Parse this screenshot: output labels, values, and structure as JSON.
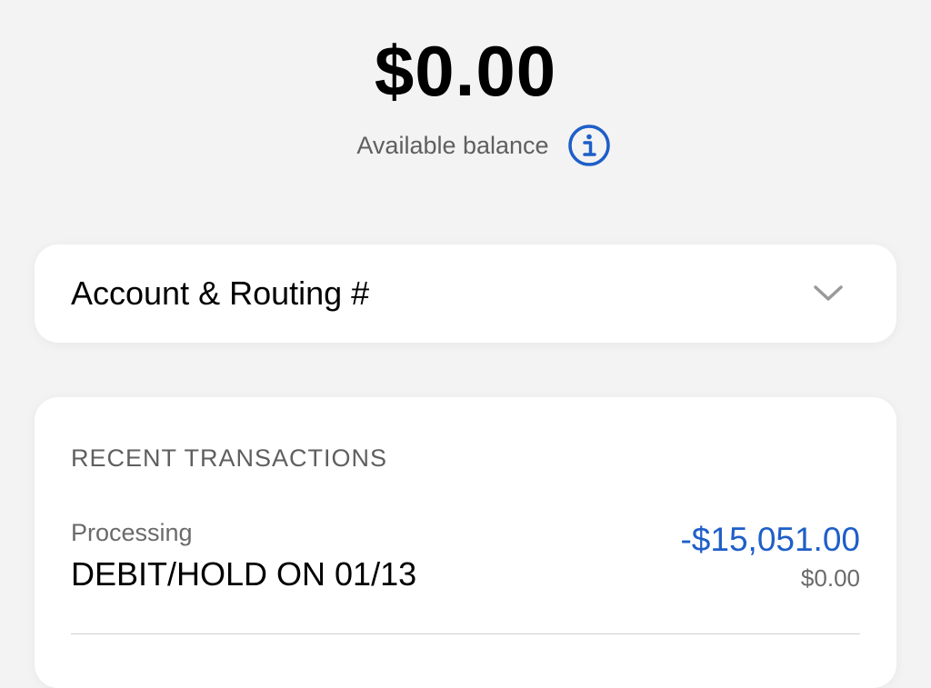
{
  "balance": {
    "amount": "$0.00",
    "label": "Available balance"
  },
  "account_card": {
    "label": "Account & Routing #"
  },
  "transactions": {
    "header": "RECENT TRANSACTIONS",
    "items": [
      {
        "status": "Processing",
        "description": "DEBIT/HOLD ON 01/13",
        "amount": "-$15,051.00",
        "running_balance": "$0.00"
      }
    ]
  },
  "colors": {
    "accent": "#1e5fc8",
    "background": "#f3f3f3"
  },
  "icons": {
    "info": "info-icon",
    "expand": "chevron-down-icon"
  }
}
